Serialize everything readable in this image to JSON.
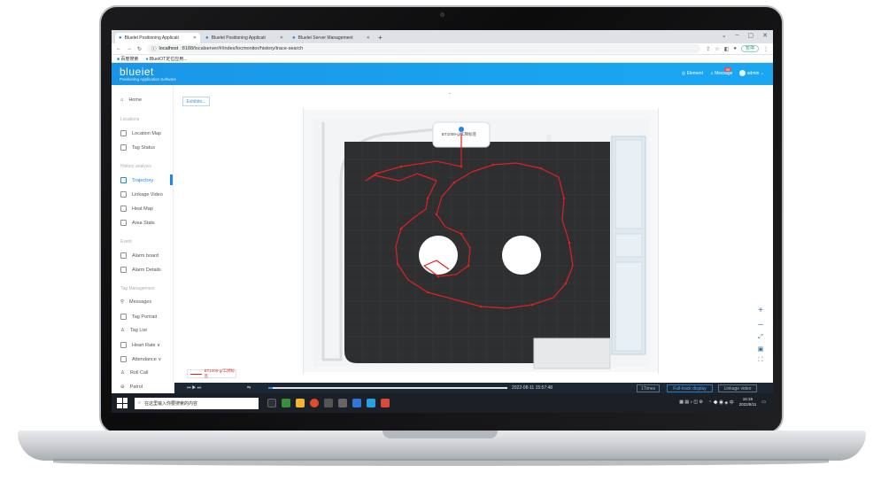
{
  "browser": {
    "tabs": [
      {
        "label": "Bluelet Positioning Applicati",
        "active": true
      },
      {
        "label": "Bluelet Positioning Applicati",
        "active": false
      },
      {
        "label": "Bluelet Server Management",
        "active": false
      }
    ],
    "new_tab": "+",
    "window_controls": [
      "⌄",
      "–",
      "▢",
      "✕"
    ],
    "url_host": "localhost",
    "url_path": ":8188/localserver/#/index/locmonitor/history/trace-search",
    "sync_label": "暂停",
    "bookmarks": [
      "百度搜索",
      "BlueIOT定位应用..."
    ]
  },
  "app": {
    "logo": "blueiet",
    "logo_subtitle": "Positioning Application Software",
    "header_right": {
      "element_label": "Element",
      "message_label": "Message",
      "message_count": "99",
      "user_label": "admin"
    }
  },
  "sidebar": {
    "items": [
      {
        "label": "Home",
        "active": false
      },
      {
        "group": "Locations"
      },
      {
        "label": "Location Map",
        "active": false
      },
      {
        "label": "Tag Status",
        "active": false
      },
      {
        "group": "History analysis"
      },
      {
        "label": "Trajectory",
        "active": true
      },
      {
        "label": "Linkage Video",
        "active": false
      },
      {
        "label": "Heat Map",
        "active": false
      },
      {
        "label": "Area Stats",
        "active": false
      },
      {
        "group": "Event"
      },
      {
        "label": "Alarm board",
        "active": false
      },
      {
        "label": "Alarm Details",
        "active": false
      },
      {
        "group": "Tag Management"
      },
      {
        "label": "Messages",
        "active": false
      },
      {
        "label": "Tag Portrait",
        "active": false
      },
      {
        "label": "Tag List",
        "active": false
      },
      {
        "label": "Heart Rate ∨",
        "active": false
      },
      {
        "label": "Attendance ∨",
        "active": false
      },
      {
        "label": "Roll Call",
        "active": false
      },
      {
        "label": "Patrol",
        "active": false
      }
    ]
  },
  "main": {
    "exhibit_button": "Exhibito...",
    "map_tag_label": "BT1009-g/工牌标签",
    "legend_label": "BT1009-g/工牌标签",
    "map_controls": [
      "+",
      "–",
      "⤢",
      "▣",
      "⛶"
    ],
    "trail_color": "#e02020"
  },
  "playback": {
    "controls": "⏮ ▶ ⏭",
    "loop_icon": "⇆",
    "progress": 0.02,
    "timestamp": "2022-08-11 15:57:48",
    "buttons": [
      "1Times",
      "Full-track display",
      "Linkage video"
    ]
  },
  "taskbar": {
    "search_placeholder": "在这里输入你要搜索的内容",
    "tray_time": "15:18",
    "tray_date": "2022/8/11"
  }
}
